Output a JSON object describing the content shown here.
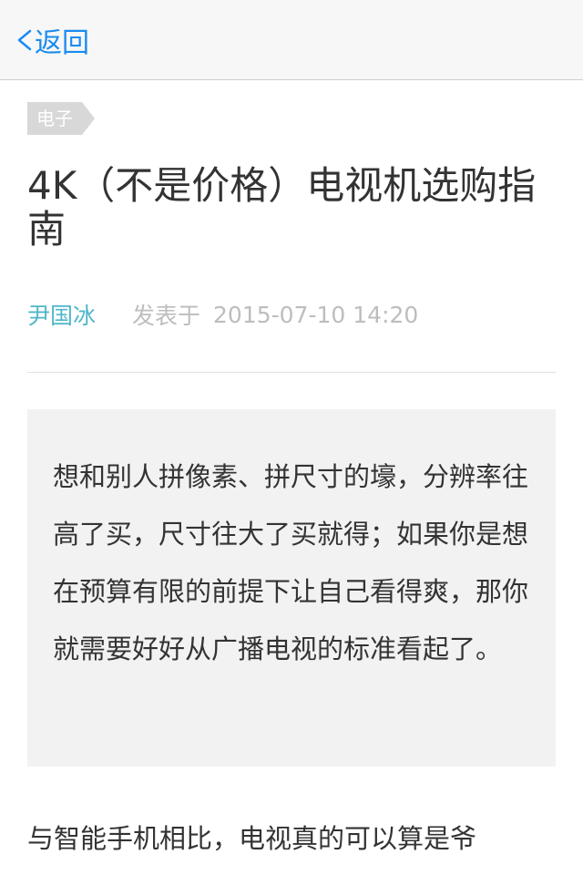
{
  "nav": {
    "back_label": "返回"
  },
  "article": {
    "category": "电子",
    "title": "4K（不是价格）电视机选购指南",
    "author": "尹国冰",
    "posted_label": "发表于",
    "date": "2015-07-10 14:20",
    "summary": "想和别人拼像素、拼尺寸的壕，分辨率往高了买，尺寸往大了买就得；如果你是想在预算有限的前提下让自己看得爽，那你就需要好好从广播电视的标准看起了。",
    "body_first_line": "与智能手机相比，电视真的可以算是爷"
  },
  "colors": {
    "accent": "#1a8cf0",
    "author": "#4fb7c9",
    "muted": "#bdbdbd",
    "tag_bg": "#d8d8d8",
    "summary_bg": "#f2f2f2"
  }
}
